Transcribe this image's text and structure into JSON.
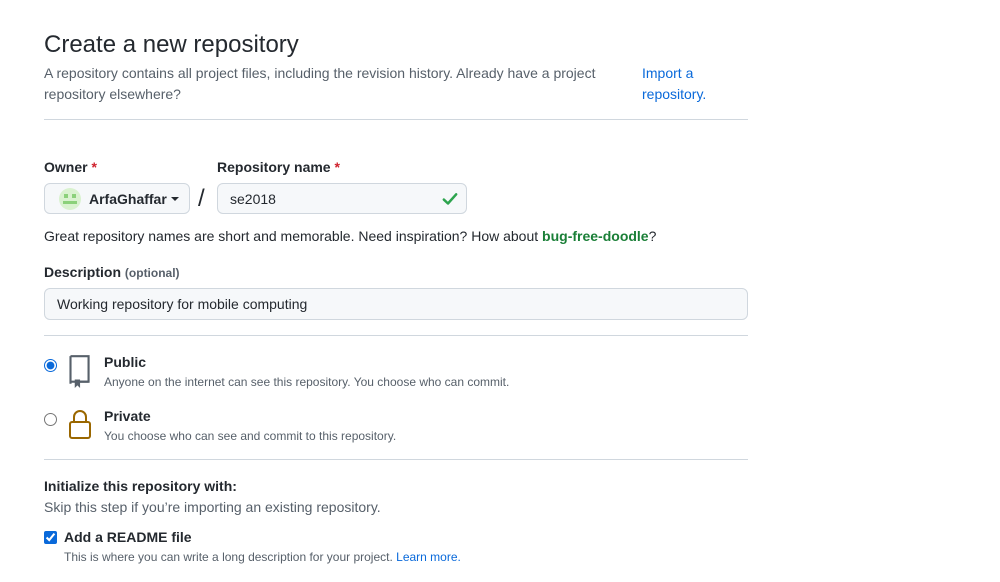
{
  "header": {
    "title": "Create a new repository",
    "subtitle": "A repository contains all project files, including the revision history. Already have a project repository elsewhere?",
    "import_link": "Import a repository."
  },
  "owner": {
    "label": "Owner",
    "required_mark": "*",
    "selected": "ArfaGhaffar",
    "icon": "chevron-down-icon"
  },
  "separator": "/",
  "repo_name": {
    "label": "Repository name",
    "required_mark": "*",
    "value": "se2018",
    "status_icon": "check-icon",
    "status_color": "#1a7f37"
  },
  "hint": {
    "text": "Great repository names are short and memorable. Need inspiration? How about ",
    "suggestion": "bug-free-doodle",
    "suffix": "?"
  },
  "description": {
    "label": "Description",
    "optional": "(optional)",
    "value": "Working repository for mobile computing"
  },
  "visibility": {
    "selected": "public",
    "options": [
      {
        "id": "public",
        "title": "Public",
        "desc": "Anyone on the internet can see this repository. You choose who can commit.",
        "icon": "repo-icon"
      },
      {
        "id": "private",
        "title": "Private",
        "desc": "You choose who can see and commit to this repository.",
        "icon": "lock-icon"
      }
    ]
  },
  "initialize": {
    "title": "Initialize this repository with:",
    "subtitle": "Skip this step if you’re importing an existing repository.",
    "readme": {
      "label": "Add a README file",
      "checked": true,
      "desc": "This is where you can write a long description for your project. ",
      "link": "Learn more."
    }
  },
  "colors": {
    "accent": "#0969da",
    "success": "#1a7f37",
    "required": "#cf222e",
    "lock": "#9a6700"
  }
}
